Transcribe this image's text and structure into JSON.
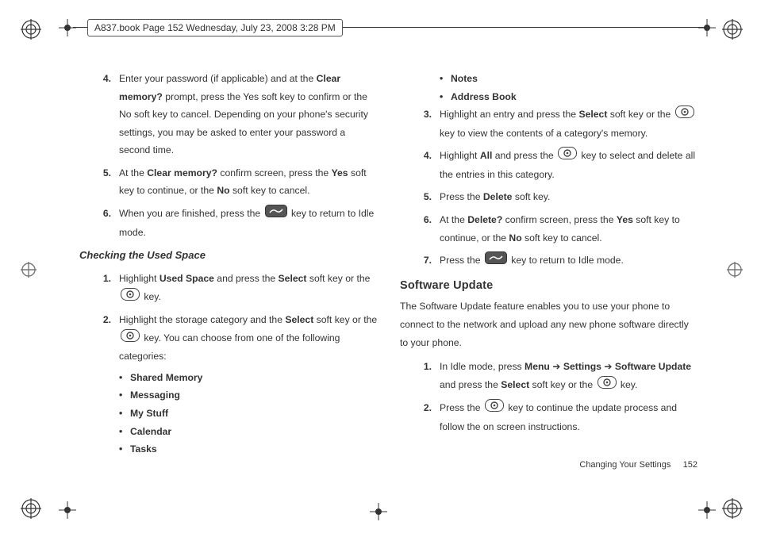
{
  "header": {
    "text": "A837.book  Page 152  Wednesday, July 23, 2008  3:28 PM"
  },
  "left": {
    "step4": {
      "num": "4.",
      "pre": "Enter your password (if applicable) and at the ",
      "bold1": "Clear memory?",
      "post1": " prompt, press the Yes soft key to confirm or the No soft key to cancel. Depending on your phone's security settings, you may be asked to enter your password a second time."
    },
    "step5": {
      "num": "5.",
      "pre": "At the ",
      "bold1": "Clear memory?",
      "mid": " confirm screen, press the ",
      "bold2": "Yes",
      "mid2": " soft key to continue, or the ",
      "bold3": "No",
      "post": " soft key to cancel."
    },
    "step6": {
      "num": "6.",
      "pre": "When you are finished, press the ",
      "post": " key to return to Idle mode."
    },
    "subhead": "Checking the Used Space",
    "c1": {
      "num": "1.",
      "pre": "Highlight ",
      "bold1": "Used Space",
      "mid": " and press the ",
      "bold2": "Select",
      "mid2": " soft key or the ",
      "post": " key."
    },
    "c2": {
      "num": "2.",
      "pre": "Highlight the storage category and the ",
      "bold1": "Select",
      "mid": " soft key or the ",
      "post": " key. You can choose from one of the following categories:"
    },
    "bullets": {
      "b1": "Shared Memory",
      "b2": "Messaging",
      "b3": "My Stuff",
      "b4": "Calendar",
      "b5": "Tasks"
    }
  },
  "right": {
    "bullets": {
      "b1": "Notes",
      "b2": "Address Book"
    },
    "r3": {
      "num": "3.",
      "pre": "Highlight an entry and press the ",
      "bold1": "Select",
      "mid": " soft key or the ",
      "post": " key to view the contents of a category's memory."
    },
    "r4": {
      "num": "4.",
      "pre": "Highlight ",
      "bold1": "All",
      "mid": " and press the ",
      "post": " key to select and delete all the entries in this category."
    },
    "r5": {
      "num": "5.",
      "pre": "Press the ",
      "bold1": "Delete",
      "post": " soft key."
    },
    "r6": {
      "num": "6.",
      "pre": "At the ",
      "bold1": "Delete?",
      "mid": " confirm screen, press the ",
      "bold2": "Yes",
      "mid2": " soft key to continue, or the ",
      "bold3": "No",
      "post": " soft key to cancel."
    },
    "r7": {
      "num": "7.",
      "pre": "Press the ",
      "post": " key to return to Idle mode."
    },
    "section": "Software Update",
    "intro": "The Software Update feature enables you to use your phone to connect to the network and upload any new phone software directly to your phone.",
    "s1": {
      "num": "1.",
      "pre": "In Idle mode, press ",
      "bold1": "Menu",
      "arrow1": " ➔ ",
      "bold2": "Settings",
      "arrow2": " ➔ ",
      "bold3": "Software Update",
      "mid": " and press the ",
      "bold4": "Select",
      "mid2": " soft key or the ",
      "post": " key."
    },
    "s2": {
      "num": "2.",
      "pre": "Press the ",
      "post": " key to continue the update process and follow the on screen instructions."
    }
  },
  "footer": {
    "chapter": "Changing Your Settings",
    "page": "152"
  }
}
